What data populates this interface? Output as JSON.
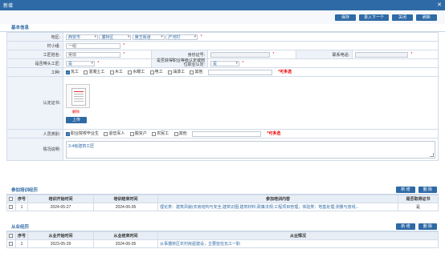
{
  "window": {
    "title": "新增",
    "close": "✕"
  },
  "toolbar": {
    "save": "保存",
    "save_next": "录入下一个",
    "close": "关闭",
    "refresh": "刷新"
  },
  "section_basic": "基本信息",
  "form": {
    "region_label": "地区:",
    "region_values": [
      "西安市",
      "灞桥区",
      "席王街道",
      "浐河村"
    ],
    "village_label": "村小组:",
    "village_value": "一组",
    "name_label": "工匠姓名:",
    "name_value": "吴琼",
    "id_label": "身份证号:",
    "phone_label": "联系电话:",
    "leader_label": "是否带头工匠:",
    "leader_value": "是",
    "cert_q_label": "是否获得职业等级认定或岗位职业认定:",
    "cert_q_value": "是",
    "trade_label": "工种:",
    "trades": [
      {
        "label": "瓦工",
        "checked": true
      },
      {
        "label": "混凝土工",
        "checked": false
      },
      {
        "label": "木工",
        "checked": false
      },
      {
        "label": "水暖工",
        "checked": false
      },
      {
        "label": "电工",
        "checked": false
      },
      {
        "label": "油漆工",
        "checked": false
      },
      {
        "label": "其他",
        "checked": false
      }
    ],
    "multi_hint": "*可多选",
    "cert_label": "认定证书:",
    "delete_label": "删除",
    "upload_label": "上传",
    "category_label": "人员类别:",
    "categories": [
      {
        "label": "职业院校毕业生",
        "checked": true
      },
      {
        "label": "退伍军人",
        "checked": false
      },
      {
        "label": "脱贫户",
        "checked": false
      },
      {
        "label": "农民工",
        "checked": false
      },
      {
        "label": "其他",
        "checked": false
      }
    ],
    "category_hint": "*可多选",
    "desc_label": "情况说明:",
    "desc_value": "3-4级建筑工匠"
  },
  "training": {
    "title": "参加培训经历",
    "add": "新 增",
    "remove": "删 除",
    "headers": [
      "序号",
      "培训开始时间",
      "培训结束时间",
      "参加培训内容",
      "是否取得证书"
    ],
    "rows": [
      {
        "no": "1",
        "start": "2024-05-27",
        "end": "2024-06-05",
        "content": "理论类：建筑风貌(农房结构与安全;建筑识图;建筑材料;政策法规;工程项目管理；体验类：地基处理;测量与放线...",
        "cert": "是"
      }
    ]
  },
  "work": {
    "title": "从业经历",
    "add": "新 增",
    "remove": "删 除",
    "headers": [
      "序号",
      "从业开始时间",
      "从业结束时间",
      "从业情况"
    ],
    "rows": [
      {
        "no": "1",
        "start": "2023-05-29",
        "end": "2024-06-05",
        "content": "从事灞桥区农村房屋建设，主要担任瓦工一职"
      }
    ]
  }
}
